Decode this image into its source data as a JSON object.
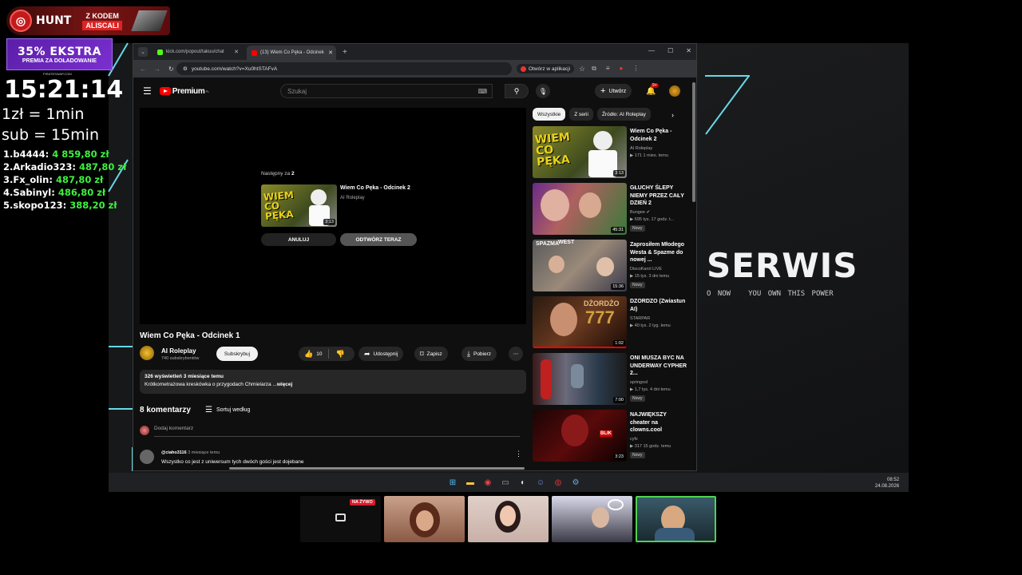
{
  "overlay": {
    "hunt_brand": "HUNT",
    "hunt_code_label": "Z KODEM",
    "hunt_code": "ALISCALI",
    "promo_big": "35% EKSTRA",
    "promo_small": "PREMIA ZA DOŁADOWANIE",
    "promo_site": "PIRATESWAP.COM",
    "clock": "15:21:14",
    "rate_money": "1zł = 1min",
    "rate_sub": "sub = 15min",
    "leaderboard": [
      {
        "name": "1.b4444:",
        "amount": "4 859,80 zł"
      },
      {
        "name": "2.Arkadio323:",
        "amount": "487,80 zł"
      },
      {
        "name": "3.Fx_olin:",
        "amount": "487,80 zł"
      },
      {
        "name": "4.Sabinyl:",
        "amount": "486,80 zł"
      },
      {
        "name": "5.skopo123:",
        "amount": "388,20 zł"
      }
    ],
    "bg_title": "SERWIS",
    "bg_tag_1": "O NOW",
    "bg_tag_2": "YOU OWN THIS POWER"
  },
  "browser": {
    "tabs": [
      {
        "title": "kick.com/popout/takuu/chat",
        "active": false
      },
      {
        "title": "(13) Wiem Co Pęka - Odcinek",
        "active": true
      }
    ],
    "url": "youtube.com/watch?v=Xu0htSTAFvA",
    "open_in_app": "Otwórz w aplikacji"
  },
  "yt": {
    "logo_text": "Premium",
    "logo_region": "PL",
    "search_placeholder": "Szukaj",
    "create_label": "Utwórz",
    "notif_count": "9+",
    "up_next_prefix": "Następny za",
    "up_next_seconds": "2",
    "up_next_title": "Wiem Co Pęka - Odcinek 2",
    "up_next_channel": "AI Roleplay",
    "up_next_duration": "3:13",
    "thumb_art_text": "WIEM CO PĘKA",
    "cancel_label": "ANULUJ",
    "play_now_label": "ODTWÓRZ TERAZ",
    "video_title": "Wiem Co Pęka - Odcinek 1",
    "channel_name": "AI Roleplay",
    "channel_subs": "740 subskrybentów",
    "subscribe_label": "Subskrybuj",
    "like_count": "10",
    "share_label": "Udostępnij",
    "save_label": "Zapisz",
    "download_label": "Pobierz",
    "desc_stats": "326 wyświetleń  3 miesiące temu",
    "desc_text": "Krótkometrażowa kreskówka o przygodach Chmielarza ...",
    "desc_more": "więcej",
    "comments_count": "8 komentarzy",
    "sort_label": "Sortuj według",
    "add_comment_placeholder": "Dodaj komentarz",
    "comment_user": "@ciaho3116",
    "comment_time": "3 miesiące temu",
    "comment_text": "Wszystko co jest z uniwersum tych dwóch gości jest dojebane",
    "chips": [
      "Wszystkie",
      "Z serii",
      "Źródło: AI Roleplay"
    ],
    "recommendations": [
      {
        "title": "Wiem Co Pęka - Odcinek 2",
        "channel": "AI Roleplay",
        "meta": "▶ 171  1 mies. temu",
        "duration": "3:13",
        "is_new": false,
        "progress": 0
      },
      {
        "title": "GŁUCHY ŚLEPY NIEMY PRZEZ CAŁY DZIEŃ 2",
        "channel": "Bungee ✔",
        "meta": "▶ 695 tys.  17 godz. t...",
        "duration": "45:31",
        "is_new": true,
        "progress": 0
      },
      {
        "title": "Zaprosiłem Młodego Westa & Spazme do nowej ...",
        "channel": "DiscoKarol LIVE",
        "meta": "▶ 15 tys.  3 dni temu",
        "duration": "15:36",
        "is_new": true,
        "progress": 0
      },
      {
        "title": "DZORDZO (Zwiastun AI)",
        "channel": "STARPAR",
        "meta": "▶ 40 tys.  2 tyg. temu",
        "duration": "1:02",
        "is_new": false,
        "progress": 1
      },
      {
        "title": "ONI MUSZA BYC NA UNDERWAY CYPHER 2...",
        "channel": "springxol",
        "meta": "▶ 1,7 tys.  4 dni temu",
        "duration": "7:00",
        "is_new": true,
        "progress": 0
      },
      {
        "title": "NAJWIĘKSZY cheater na clowns.cool",
        "channel": "cyfx",
        "meta": "▶ 317  15 godz. temu",
        "duration": "3:23",
        "is_new": true,
        "progress": 0
      }
    ],
    "new_label": "Nowy"
  },
  "taskbar": {
    "time": "08:52",
    "date": "24.08.2026"
  },
  "cams": {
    "live_label": "NA ŻYWO"
  },
  "colors": {
    "yt_red": "#ff0000",
    "leader_green": "#3ef03e",
    "neon_cyan": "#66d9e8",
    "active_cam_border": "#4fd34f"
  }
}
